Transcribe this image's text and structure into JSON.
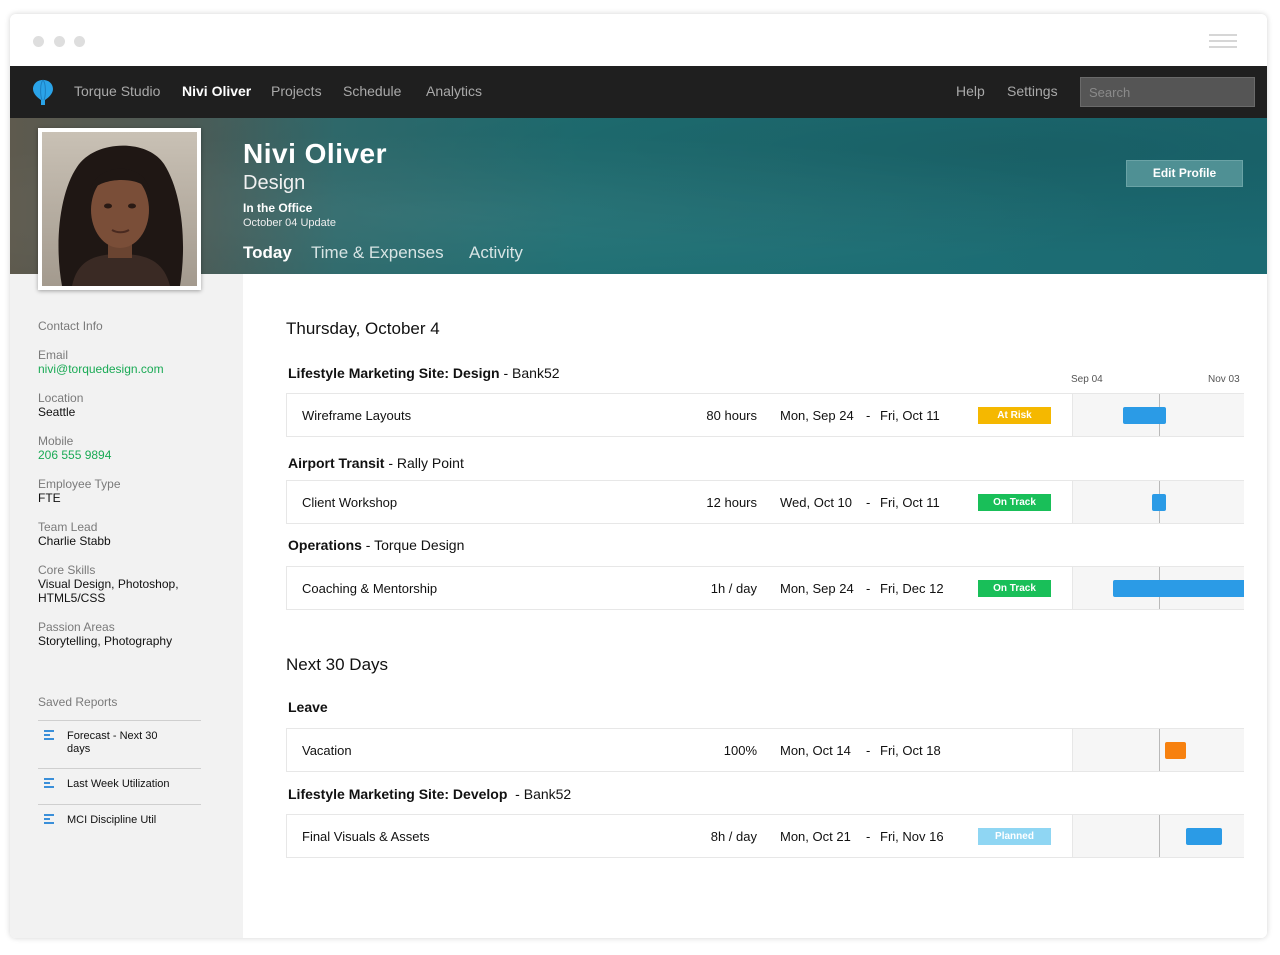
{
  "nav": {
    "items": [
      {
        "label": "Torque Studio",
        "active": false
      },
      {
        "label": "Nivi Oliver",
        "active": true
      },
      {
        "label": "Projects",
        "active": false
      },
      {
        "label": "Schedule",
        "active": false
      },
      {
        "label": "Analytics",
        "active": false
      }
    ],
    "right_items": [
      {
        "label": "Help"
      },
      {
        "label": "Settings"
      }
    ],
    "search_placeholder": "Search"
  },
  "profile": {
    "name": "Nivi Oliver",
    "department": "Design",
    "status": "In the Office",
    "update": "October 04 Update",
    "edit_label": "Edit Profile",
    "tabs": [
      {
        "label": "Today",
        "active": true
      },
      {
        "label": "Time & Expenses",
        "active": false
      },
      {
        "label": "Activity",
        "active": false
      }
    ]
  },
  "sidebar": {
    "heading": "Contact Info",
    "fields": [
      {
        "label": "Email",
        "value": "nivi@torquedesign.com",
        "link": true
      },
      {
        "label": "Location",
        "value": "Seattle",
        "link": false
      },
      {
        "label": "Mobile",
        "value": "206 555 9894",
        "link": true
      },
      {
        "label": "Employee Type",
        "value": "FTE",
        "link": false
      },
      {
        "label": "Team Lead",
        "value": "Charlie Stabb",
        "link": false
      },
      {
        "label": "Core Skills",
        "value": "Visual Design, Photoshop, HTML5/CSS",
        "link": false
      },
      {
        "label": "Passion Areas",
        "value": "Storytelling, Photography",
        "link": false
      }
    ],
    "reports_heading": "Saved Reports",
    "reports": [
      {
        "label": "Forecast - Next 30 days"
      },
      {
        "label": "Last Week Utilization"
      },
      {
        "label": "MCI Discipline Util"
      }
    ]
  },
  "main": {
    "today_title": "Thursday, October 4",
    "timeline_start": "Sep 04",
    "timeline_end": "Nov 03",
    "today_groups": [
      {
        "project": "Lifestyle Marketing Site: Design",
        "client": " - Bank52",
        "tasks": [
          {
            "name": "Wireframe Layouts",
            "hours": "80 hours",
            "start": "Mon, Sep 24",
            "end": "Fri, Oct 11",
            "status": "At Risk",
            "status_color": "#f5b800",
            "bar_color": "#2b9be6"
          }
        ]
      },
      {
        "project": "Airport Transit",
        "client": " - Rally Point",
        "tasks": [
          {
            "name": "Client Workshop",
            "hours": "12 hours",
            "start": "Wed, Oct 10",
            "end": "Fri, Oct 11",
            "status": "On Track",
            "status_color": "#19bf59",
            "bar_color": "#2b9be6"
          }
        ]
      },
      {
        "project": "Operations",
        "client": " - Torque Design",
        "tasks": [
          {
            "name": "Coaching & Mentorship",
            "hours": "1h / day",
            "start": "Mon, Sep 24",
            "end": "Fri, Dec 12",
            "status": "On Track",
            "status_color": "#19bf59",
            "bar_color": "#2b9be6"
          }
        ]
      }
    ],
    "next_title": "Next 30 Days",
    "next_groups": [
      {
        "project": "Leave",
        "client": "",
        "tasks": [
          {
            "name": "Vacation",
            "hours": "100%",
            "start": "Mon, Oct 14",
            "end": "Fri, Oct 18",
            "status": "",
            "status_color": "",
            "bar_color": "#f7810f"
          }
        ]
      },
      {
        "project": "Lifestyle Marketing Site: Develop",
        "client": "  - Bank52",
        "tasks": [
          {
            "name": "Final Visuals & Assets",
            "hours": "8h / day",
            "start": "Mon, Oct 21",
            "end": "Fri, Nov 16",
            "status": "Planned",
            "status_color": "#8fd6f3",
            "bar_color": "#2b9be6"
          }
        ]
      }
    ]
  }
}
